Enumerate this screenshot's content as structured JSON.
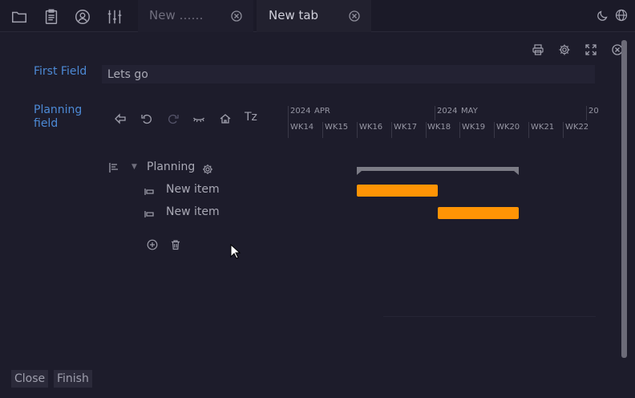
{
  "toolbar": {
    "icons": [
      "folder-icon",
      "clipboard-icon",
      "user-circle-icon",
      "sliders-icon",
      "moon-icon",
      "globe-icon"
    ]
  },
  "tabs": [
    {
      "label": "New ……",
      "active": false
    },
    {
      "label": "New tab",
      "active": true
    }
  ],
  "panel_controls": [
    "print-icon",
    "settings-icon",
    "fullscreen-icon",
    "close-icon"
  ],
  "form": {
    "first_field": {
      "label": "First Field",
      "value": "Lets go"
    },
    "planning_field": {
      "label": "Planning field"
    }
  },
  "planning": {
    "tools": {
      "tz_label": "Tz"
    },
    "timeline": {
      "months": [
        {
          "year": "2024",
          "month": "APR"
        },
        {
          "year": "2024",
          "month": "MAY"
        },
        {
          "year": "20",
          "month": ""
        }
      ],
      "weeks": [
        "WK14",
        "WK15",
        "WK16",
        "WK17",
        "WK18",
        "WK19",
        "WK20",
        "WK21",
        "WK22"
      ]
    },
    "group": {
      "label": "Planning"
    },
    "items": [
      {
        "label": "New item"
      },
      {
        "label": "New item"
      }
    ],
    "colors": {
      "task_bar": "#ff9405",
      "summary_bar": "#7c7c86"
    }
  },
  "footer": {
    "close_label": "Close",
    "finish_label": "Finish"
  },
  "theme": {
    "background": "#1d1c2b",
    "accent_label": "#4d8ad6"
  }
}
